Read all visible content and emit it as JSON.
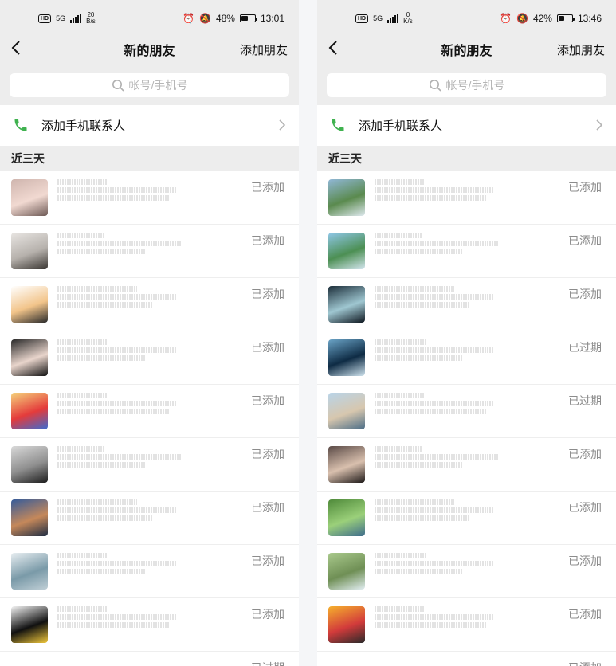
{
  "left": {
    "status": {
      "hd": "HD",
      "net": "5G",
      "speed_value": "20",
      "speed_unit": "B/s",
      "battery_pct": "48%",
      "battery_fill": 0.48,
      "time": "13:01"
    },
    "header": {
      "title": "新的朋友",
      "action": "添加朋友"
    },
    "search": {
      "placeholder": "帐号/手机号"
    },
    "add_contacts": {
      "label": "添加手机联系人"
    },
    "section": {
      "label": "近三天"
    },
    "items": [
      {
        "status": "已添加",
        "avatar": [
          "#cfb5ae",
          "#f1d9d1",
          "#6d5955"
        ]
      },
      {
        "status": "已添加",
        "avatar": [
          "#e8e5e2",
          "#b6b1ac",
          "#3a3632"
        ]
      },
      {
        "status": "已添加",
        "avatar": [
          "#ffffff",
          "#f2c48a",
          "#2b2b2b"
        ]
      },
      {
        "status": "已添加",
        "avatar": [
          "#2a2a2a",
          "#e9d5cc",
          "#111111"
        ]
      },
      {
        "status": "已添加",
        "avatar": [
          "#f5d17b",
          "#e43b3b",
          "#3c6bd1"
        ]
      },
      {
        "status": "已添加",
        "avatar": [
          "#d9d9d9",
          "#8f8f8f",
          "#1d1d1d"
        ]
      },
      {
        "status": "已添加",
        "avatar": [
          "#355b9a",
          "#c5885a",
          "#1f2d43"
        ]
      },
      {
        "status": "已添加",
        "avatar": [
          "#e8eef1",
          "#7a9aa8",
          "#c0cfd6"
        ]
      },
      {
        "status": "已添加",
        "avatar": [
          "#f4f4f4",
          "#101010",
          "#f0c73a"
        ]
      }
    ],
    "partial": {
      "status": "已过期"
    }
  },
  "right": {
    "status": {
      "hd": "HD",
      "net": "5G",
      "speed_value": "0",
      "speed_unit": "K/s",
      "battery_pct": "42%",
      "battery_fill": 0.42,
      "time": "13:46"
    },
    "header": {
      "title": "新的朋友",
      "action": "添加朋友"
    },
    "search": {
      "placeholder": "帐号/手机号"
    },
    "add_contacts": {
      "label": "添加手机联系人"
    },
    "section": {
      "label": "近三天"
    },
    "items": [
      {
        "status": "已添加",
        "avatar": [
          "#90b7d6",
          "#5a8a4e",
          "#dfe9ef"
        ]
      },
      {
        "status": "已添加",
        "avatar": [
          "#8fc7e8",
          "#4c8f53",
          "#d4e6ef"
        ]
      },
      {
        "status": "已添加",
        "avatar": [
          "#1c2e3a",
          "#9fc7d1",
          "#0e1720"
        ]
      },
      {
        "status": "已过期",
        "avatar": [
          "#6aa3c6",
          "#0e2b44",
          "#cfe3ee"
        ]
      },
      {
        "status": "已过期",
        "avatar": [
          "#b9d4e8",
          "#d7c7ae",
          "#4b6d87"
        ]
      },
      {
        "status": "已添加",
        "avatar": [
          "#5a4a46",
          "#d9c0ae",
          "#1e1918"
        ]
      },
      {
        "status": "已添加",
        "avatar": [
          "#4f8a3a",
          "#9bd07a",
          "#3e6c8c"
        ]
      },
      {
        "status": "已添加",
        "avatar": [
          "#a9c98c",
          "#6f8f55",
          "#e2eef2"
        ]
      },
      {
        "status": "已添加",
        "avatar": [
          "#f6b02c",
          "#d23b3b",
          "#2a2a2a"
        ]
      }
    ],
    "partial": {
      "status": "已添加"
    }
  }
}
